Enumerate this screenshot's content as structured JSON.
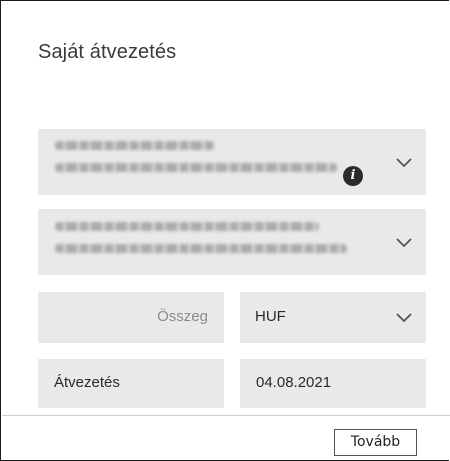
{
  "dialog": {
    "title": "Saját átvezetés"
  },
  "source_account": {
    "icon": "info-icon",
    "info_glyph": "i",
    "dropdown_icon": "chevron-down-icon"
  },
  "target_account": {
    "dropdown_icon": "chevron-down-icon"
  },
  "amount": {
    "placeholder": "Összeg",
    "value": ""
  },
  "currency": {
    "selected": "HUF",
    "dropdown_icon": "chevron-down-icon"
  },
  "transfer_type": {
    "label": "Átvezetés"
  },
  "date": {
    "value": "04.08.2021"
  },
  "footer": {
    "next_label": "Tovább"
  },
  "colors": {
    "field_background": "#e9e9e9",
    "text": "#2a2a2a",
    "placeholder": "#8a8a8a"
  }
}
